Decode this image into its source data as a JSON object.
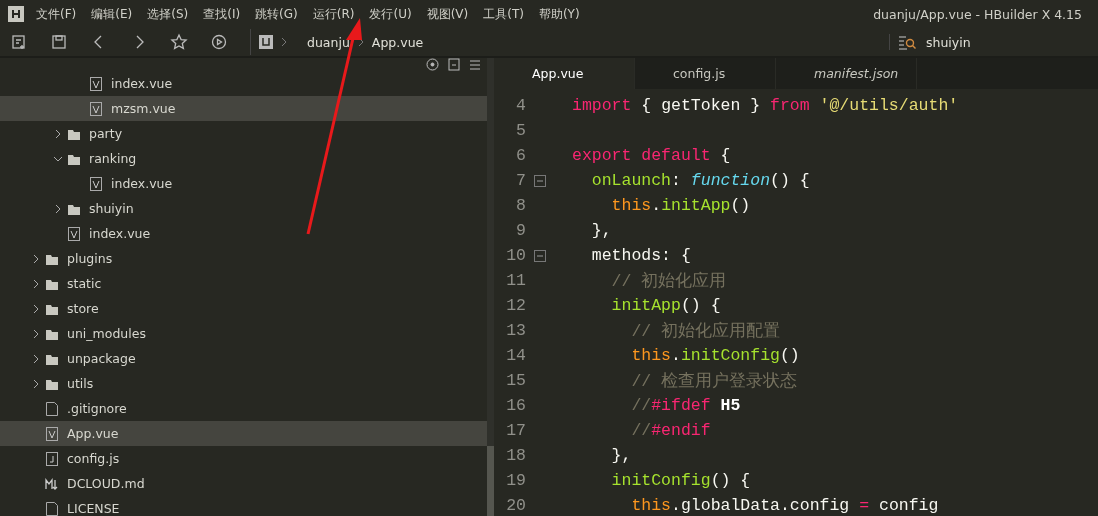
{
  "window": {
    "title": "duanju/App.vue - HBuilder X 4.15"
  },
  "menu": [
    "文件(F)",
    "编辑(E)",
    "选择(S)",
    "查找(I)",
    "跳转(G)",
    "运行(R)",
    "发行(U)",
    "视图(V)",
    "工具(T)",
    "帮助(Y)"
  ],
  "breadcrumb": [
    "duanju",
    "App.vue"
  ],
  "search": {
    "value": "shuiyin"
  },
  "tree": [
    {
      "children": [
        {
          "children": [
            {
              "label": "index.vue",
              "kind": "vue",
              "selected": false
            },
            {
              "label": "mzsm.vue",
              "kind": "vue",
              "selected": true
            }
          ]
        },
        {
          "label": "party",
          "kind": "folder",
          "expanded": false,
          "selected": false
        },
        {
          "label": "ranking",
          "kind": "folder",
          "expanded": true,
          "selected": false,
          "children": [
            {
              "label": "index.vue",
              "kind": "vue",
              "selected": false
            }
          ]
        },
        {
          "label": "shuiyin",
          "kind": "folder",
          "expanded": false,
          "selected": false
        },
        {
          "label": "index.vue",
          "kind": "vue",
          "selected": false
        }
      ]
    },
    {
      "label": "plugins",
      "kind": "folder",
      "expanded": false,
      "selected": false
    },
    {
      "label": "static",
      "kind": "folder",
      "expanded": false,
      "selected": false
    },
    {
      "label": "store",
      "kind": "folder",
      "expanded": false,
      "selected": false
    },
    {
      "label": "uni_modules",
      "kind": "folder",
      "expanded": false,
      "selected": false
    },
    {
      "label": "unpackage",
      "kind": "folder",
      "expanded": false,
      "selected": false
    },
    {
      "label": "utils",
      "kind": "folder",
      "expanded": false,
      "selected": false
    },
    {
      "label": ".gitignore",
      "kind": "file",
      "selected": false
    },
    {
      "label": "App.vue",
      "kind": "vue",
      "selected": true
    },
    {
      "label": "config.js",
      "kind": "js",
      "selected": false
    },
    {
      "label": "DCLOUD.md",
      "kind": "md",
      "selected": false
    },
    {
      "label": "LICENSE",
      "kind": "file",
      "selected": false
    }
  ],
  "tabs": [
    {
      "label": "App.vue",
      "selected": true,
      "italic": false
    },
    {
      "label": "config.js",
      "selected": false,
      "italic": false
    },
    {
      "label": "manifest.json",
      "selected": false,
      "italic": true
    }
  ],
  "code": [
    {
      "number": "4",
      "fold": false,
      "tokens": [
        {
          "kind": "keyword",
          "text": "import"
        },
        {
          "kind": "plain",
          "text": " { getToken } "
        },
        {
          "kind": "keyword",
          "text": "from"
        },
        {
          "kind": "string",
          "text": " '@/utils/auth'"
        }
      ]
    },
    {
      "number": "5",
      "fold": false
    },
    {
      "number": "6",
      "fold": false,
      "tokens": [
        {
          "kind": "keyword",
          "text": "export default"
        },
        {
          "kind": "plain",
          "text": " {"
        }
      ]
    },
    {
      "number": "7",
      "fold": true,
      "tokens": [
        {
          "kind": "func",
          "text": "  onLaunch"
        },
        {
          "kind": "plain",
          "text": ": "
        },
        {
          "kind": "storage",
          "text": "function"
        },
        {
          "kind": "plain",
          "text": "() {"
        }
      ]
    },
    {
      "number": "8",
      "fold": false,
      "tokens": [
        {
          "kind": "this",
          "text": "    this"
        },
        {
          "kind": "plain",
          "text": "."
        },
        {
          "kind": "func",
          "text": "initApp"
        },
        {
          "kind": "plain",
          "text": "()"
        }
      ]
    },
    {
      "number": "9",
      "fold": false,
      "tokens": [
        {
          "kind": "plain",
          "text": "  },"
        }
      ]
    },
    {
      "number": "10",
      "fold": true,
      "tokens": [
        {
          "kind": "plain",
          "text": "  methods: {"
        }
      ]
    },
    {
      "number": "11",
      "fold": false,
      "tokens": [
        {
          "kind": "comment",
          "text": "    // 初始化应用"
        }
      ]
    },
    {
      "number": "12",
      "fold": false,
      "tokens": [
        {
          "kind": "func",
          "text": "    initApp"
        },
        {
          "kind": "plain",
          "text": "() {"
        }
      ]
    },
    {
      "number": "13",
      "fold": false,
      "tokens": [
        {
          "kind": "comment",
          "text": "      // 初始化应用配置"
        }
      ]
    },
    {
      "number": "14",
      "fold": false,
      "tokens": [
        {
          "kind": "this",
          "text": "      this"
        },
        {
          "kind": "plain",
          "text": "."
        },
        {
          "kind": "func",
          "text": "initConfig"
        },
        {
          "kind": "plain",
          "text": "()"
        }
      ]
    },
    {
      "number": "15",
      "fold": false,
      "tokens": [
        {
          "kind": "comment",
          "text": "      // 检查用户登录状态"
        }
      ]
    },
    {
      "number": "16",
      "fold": false,
      "tokens": [
        {
          "kind": "comment",
          "text": "      //"
        },
        {
          "kind": "keyword",
          "text": "#ifdef"
        },
        {
          "kind": "bold",
          "text": " H5"
        }
      ]
    },
    {
      "number": "17",
      "fold": false,
      "tokens": [
        {
          "kind": "comment",
          "text": "      //"
        },
        {
          "kind": "keyword",
          "text": "#endif"
        }
      ]
    },
    {
      "number": "18",
      "fold": false,
      "tokens": [
        {
          "kind": "plain",
          "text": "    },"
        }
      ]
    },
    {
      "number": "19",
      "fold": false,
      "tokens": [
        {
          "kind": "func",
          "text": "    initConfig"
        },
        {
          "kind": "plain",
          "text": "() {"
        }
      ]
    },
    {
      "number": "20",
      "fold": false,
      "tokens": [
        {
          "kind": "this",
          "text": "      this"
        },
        {
          "kind": "plain",
          "text": ".globalData.config "
        },
        {
          "kind": "keyword",
          "text": "="
        },
        {
          "kind": "plain",
          "text": " config"
        }
      ]
    }
  ]
}
